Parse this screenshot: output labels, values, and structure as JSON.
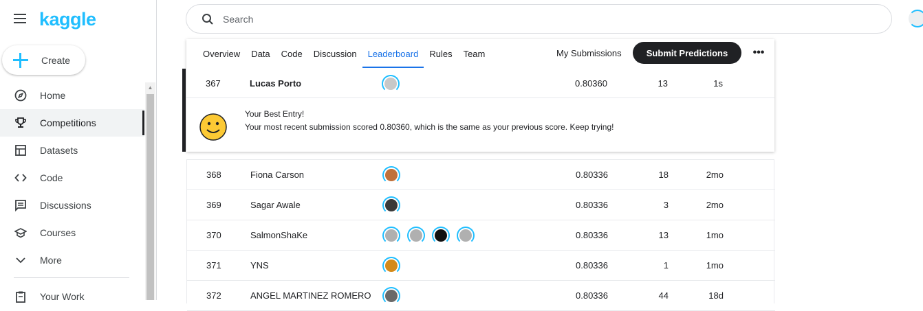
{
  "brand": {
    "logo": "kaggle",
    "accent": "#20beff"
  },
  "sidebar": {
    "create_label": "Create",
    "items": [
      {
        "label": "Home",
        "icon": "compass-icon"
      },
      {
        "label": "Competitions",
        "icon": "trophy-icon",
        "active": true
      },
      {
        "label": "Datasets",
        "icon": "table-icon"
      },
      {
        "label": "Code",
        "icon": "code-icon"
      },
      {
        "label": "Discussions",
        "icon": "comments-icon"
      },
      {
        "label": "Courses",
        "icon": "school-icon"
      },
      {
        "label": "More",
        "icon": "chevron-down-icon"
      },
      {
        "label": "Your Work",
        "icon": "clipboard-icon"
      }
    ]
  },
  "search": {
    "placeholder": "Search"
  },
  "tabs": [
    {
      "label": "Overview"
    },
    {
      "label": "Data"
    },
    {
      "label": "Code"
    },
    {
      "label": "Discussion"
    },
    {
      "label": "Leaderboard",
      "active": true
    },
    {
      "label": "Rules"
    },
    {
      "label": "Team"
    }
  ],
  "actions": {
    "my_submissions": "My Submissions",
    "submit_predictions": "Submit Predictions",
    "more": "•••"
  },
  "current_entry": {
    "rank": "367",
    "name": "Lucas Porto",
    "score": "0.80360",
    "entries": "13",
    "last": "1s"
  },
  "best_entry": {
    "title": "Your Best Entry!",
    "message": "Your most recent submission scored 0.80360, which is the same as your previous score. Keep trying!"
  },
  "leaderboard": [
    {
      "rank": "368",
      "name": "Fiona Carson",
      "score": "0.80336",
      "entries": "18",
      "last": "2mo",
      "avatars": [
        "#c0703a"
      ]
    },
    {
      "rank": "369",
      "name": "Sagar Awale",
      "score": "0.80336",
      "entries": "3",
      "last": "2mo",
      "avatars": [
        "#3a3a3a"
      ]
    },
    {
      "rank": "370",
      "name": "SalmonShaKe",
      "score": "0.80336",
      "entries": "13",
      "last": "1mo",
      "avatars": [
        "#b0b0b0",
        "#b0b0b0",
        "#111111",
        "#b0b0b0"
      ]
    },
    {
      "rank": "371",
      "name": "YNS",
      "score": "0.80336",
      "entries": "1",
      "last": "1mo",
      "avatars": [
        "#d48a1a"
      ]
    },
    {
      "rank": "372",
      "name": "ANGEL MARTINEZ ROMERO",
      "score": "0.80336",
      "entries": "44",
      "last": "18d",
      "avatars": [
        "#6a6a6a"
      ]
    }
  ]
}
